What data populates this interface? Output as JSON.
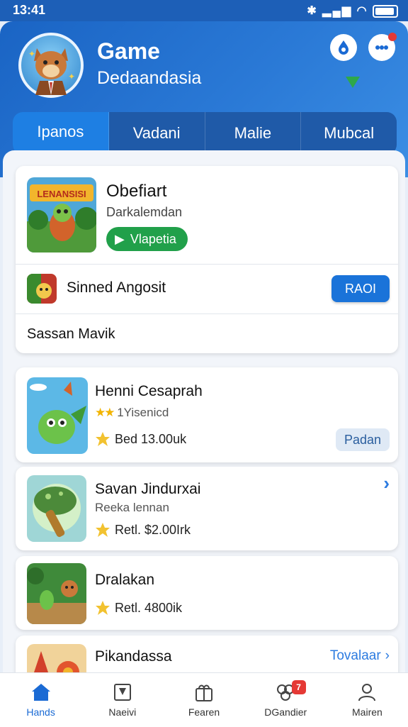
{
  "status_bar": {
    "time": "13:41",
    "icons": [
      "bluetooth-icon",
      "signal-icon",
      "wifi-icon",
      "battery-icon"
    ]
  },
  "header": {
    "title": "Game",
    "subtitle": "Dedaandasia",
    "avatar_icon": "fox-character-avatar",
    "actions": [
      "drop-icon",
      "chat-icon"
    ]
  },
  "tabs": [
    {
      "label": "Ipanos",
      "active": true
    },
    {
      "label": "Vadani",
      "active": false
    },
    {
      "label": "Malie",
      "active": false
    },
    {
      "label": "Mubcal",
      "active": false
    }
  ],
  "featured": {
    "thumb_text": "LENANSISI",
    "title": "Obefiart",
    "subtitle": "Darkalemdan",
    "pill_label": "Vlapetia",
    "pill_icon": "play-icon",
    "row_title": "Sinned Angosit",
    "button_label": "RAOI",
    "footer": "Sassan Mavik"
  },
  "list": [
    {
      "title": "Henni Cesaprah",
      "stars": "★★",
      "rating_text": "1Yisenicd",
      "price": "Bed 13.00uk",
      "tag": "Padan"
    },
    {
      "title": "Savan Jindurxai",
      "subtitle": "Reeka lennan",
      "price": "Retl. $2.00Irk",
      "chevron": "›"
    },
    {
      "title": "Dralakan",
      "price": "Retl. 4800ik"
    },
    {
      "title": "Pikandassa",
      "link": "Tovalaar",
      "chevron": "›"
    }
  ],
  "bottom_nav": [
    {
      "label": "Hands",
      "icon": "home-icon",
      "active": true
    },
    {
      "label": "Naeivi",
      "icon": "news-icon",
      "active": false
    },
    {
      "label": "Fearen",
      "icon": "gift-icon",
      "active": false
    },
    {
      "label": "DGandier",
      "icon": "clover-icon",
      "badge": "7",
      "active": false
    },
    {
      "label": "Mairen",
      "icon": "profile-icon",
      "active": false
    }
  ],
  "colors": {
    "primary": "#1a6ad4",
    "accent_green": "#21a04a",
    "badge_red": "#e53935"
  }
}
